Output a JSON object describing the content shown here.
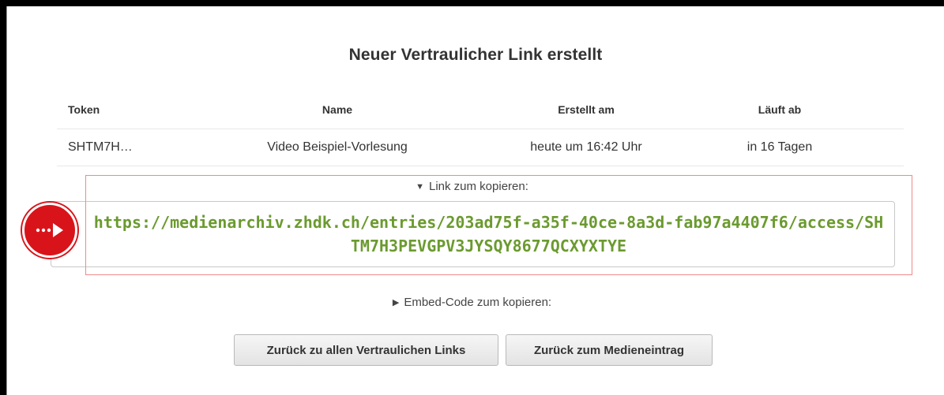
{
  "dialog": {
    "title": "Neuer Vertraulicher Link erstellt"
  },
  "table": {
    "headers": [
      "Token",
      "Name",
      "Erstellt am",
      "Läuft ab"
    ],
    "rows": [
      [
        "SHTM7H…",
        "Video Beispiel-Vorlesung",
        "heute um 16:42 Uhr",
        "in 16 Tagen"
      ]
    ]
  },
  "link_section": {
    "label": "Link zum kopieren:",
    "expanded": true,
    "url": "https://medienarchiv.zhdk.ch/entries/203ad75f-a35f-40ce-8a3d-fab97a4407f6/access/SHTM7H3PEVGPV3JYSQY8677QCXYXTYE"
  },
  "embed_section": {
    "label": "Embed-Code zum kopieren:",
    "expanded": false
  },
  "buttons": {
    "back_all": "Zurück zu allen Vertraulichen Links",
    "back_media": "Zurück zum Medieneintrag"
  },
  "colors": {
    "link_text": "#6b9a2f",
    "highlight_border": "#f08a8a",
    "marker": "#d8141a"
  },
  "icons": {
    "expanded_toggle": "triangle-down-icon",
    "collapsed_toggle": "triangle-right-icon",
    "marker": "arrow-pointer-icon"
  }
}
